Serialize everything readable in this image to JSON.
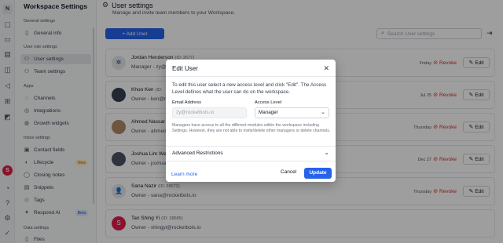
{
  "rail": {
    "logo": "N",
    "icons": [
      "inbox-icon",
      "chat-icon",
      "broadcast-icon",
      "contacts-icon",
      "megaphone-icon",
      "workflow-icon",
      "analytics-icon",
      "settings-icon",
      "user-avatar",
      "bell-icon",
      "help-icon",
      "gear-icon",
      "brand-logo-icon"
    ],
    "avatar_letter": "S"
  },
  "sidebar": {
    "title": "Workspace Settings",
    "sections": [
      {
        "label": "General settings",
        "items": [
          {
            "label": "General info",
            "icon": "document-icon"
          }
        ]
      },
      {
        "label": "User role settings",
        "items": [
          {
            "label": "User settings",
            "icon": "users-icon",
            "active": true
          },
          {
            "label": "Team settings",
            "icon": "team-icon"
          }
        ]
      },
      {
        "label": "Apps",
        "items": [
          {
            "label": "Channels",
            "icon": "channels-icon"
          },
          {
            "label": "Integrations",
            "icon": "integrations-icon"
          },
          {
            "label": "Growth widgets",
            "icon": "growth-icon"
          }
        ]
      },
      {
        "label": "Inbox settings",
        "items": [
          {
            "label": "Contact fields",
            "icon": "contact-fields-icon"
          },
          {
            "label": "Lifecycle",
            "icon": "lifecycle-icon",
            "badge": "New"
          },
          {
            "label": "Closing notes",
            "icon": "notes-icon"
          },
          {
            "label": "Snippets",
            "icon": "snippets-icon"
          },
          {
            "label": "Tags",
            "icon": "tag-icon"
          },
          {
            "label": "Respond AI",
            "icon": "ai-icon",
            "badge": "Beta"
          }
        ]
      },
      {
        "label": "Data settings",
        "items": [
          {
            "label": "Files",
            "icon": "files-icon"
          }
        ]
      }
    ]
  },
  "main": {
    "title": "User settings",
    "subtitle": "Manage and invite team members to your Workspace.",
    "add_user_label": "+ Add User",
    "search_placeholder": "Search User settings",
    "users": [
      {
        "name": "Jordan Henderson",
        "id": "(ID: 2677)",
        "role": "Manager - zy@",
        "date": "Friday",
        "avatar": "settings-avatar",
        "avatar_char": "✲",
        "avatar_color": "#e5e7eb"
      },
      {
        "name": "Khoo Ken",
        "id": "(ID:",
        "role": "Owner - ken@r",
        "date": "Jul 25",
        "avatar": "photo-avatar",
        "avatar_char": "",
        "avatar_color": "#374151"
      },
      {
        "name": "Ahmed Nassar",
        "id": "",
        "role": "Owner - ahmed",
        "date": "Thursday",
        "avatar": "photo-avatar",
        "avatar_char": "",
        "avatar_color": "#b08968"
      },
      {
        "name": "Joshua Lim Wei",
        "id": "",
        "role": "Owner - joshua",
        "date": "Dec 27",
        "avatar": "photo-avatar",
        "avatar_char": "",
        "avatar_color": "#4b5563"
      },
      {
        "name": "Sana Nazir",
        "id": "(ID: 28672)",
        "role": "Owner - sana@rocketbots.io",
        "date": "Thursday",
        "avatar": "user-icon-avatar",
        "avatar_char": "👤",
        "avatar_color": "#e5e7eb"
      },
      {
        "name": "Tan Shing Yi",
        "id": "(ID: 28685)",
        "role": "Owner - shingyi@rocketbots.io",
        "date": "Friday",
        "avatar": "letter-avatar",
        "avatar_char": "S",
        "avatar_color": "#e11d48"
      }
    ],
    "revoke_label": "Revoke",
    "edit_label": "Edit"
  },
  "modal": {
    "title": "Edit User",
    "description": "To edit this user select a new access level and click \"Edit\". The Access Level defines what the user can do on the workspace.",
    "email_label": "Email Address",
    "email_value": "zy@rocketbots.io",
    "access_label": "Access Level",
    "access_value": "Manager",
    "help_text": "Managers have access to all the different modules within the workspace including Settings. However, they are not able to invite/delete other managers or delete channels.",
    "advanced_label": "Advanced Restrictions",
    "learn_more": "Learn more",
    "cancel_label": "Cancel",
    "update_label": "Update"
  }
}
